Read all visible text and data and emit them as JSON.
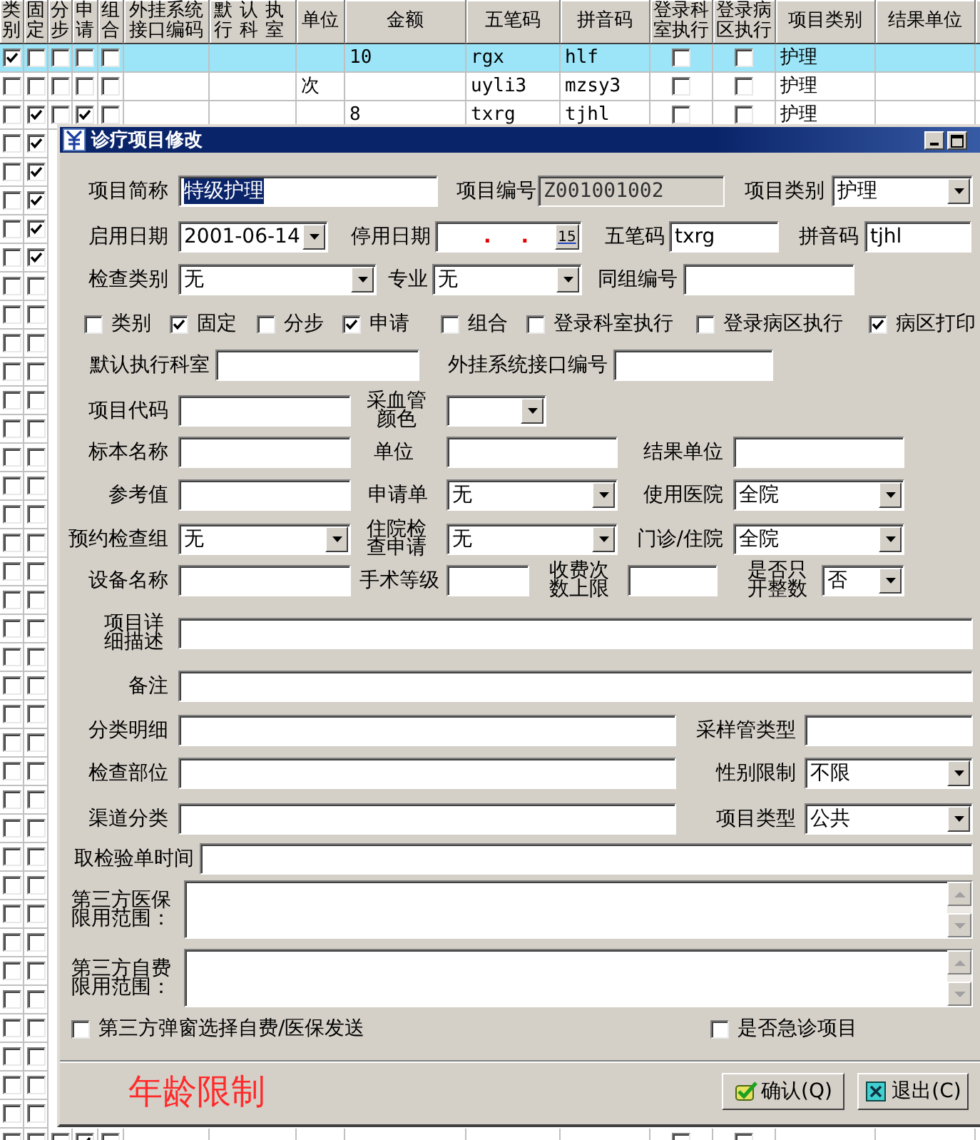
{
  "grid": {
    "columns": [
      "类别",
      "固定",
      "分步",
      "申请",
      "组合",
      "外挂系统接口编码",
      "默认执行科室",
      "单位",
      "金额",
      "五笔码",
      "拼音码",
      "登录科室执行",
      "登录病区执行",
      "项目类别",
      "结果单位"
    ],
    "rows": [
      {
        "selected": true,
        "flags": [
          true,
          false,
          false,
          false,
          false
        ],
        "amount": "10",
        "wubi": "rgx",
        "pinyin": "hlf",
        "dept_exec": false,
        "ward_exec": false,
        "category": "护理"
      },
      {
        "selected": false,
        "flags": [
          false,
          false,
          false,
          false,
          false
        ],
        "unit": "次",
        "wubi": "uyli3",
        "pinyin": "mzsy3",
        "dept_exec": false,
        "ward_exec": false,
        "category": "护理"
      },
      {
        "selected": false,
        "flags": [
          false,
          true,
          false,
          true,
          false
        ],
        "amount": "8",
        "wubi": "txrg",
        "pinyin": "tjhl",
        "dept_exec": false,
        "ward_exec": false,
        "category": "护理"
      },
      {
        "selected": false,
        "flags": [
          false,
          true
        ]
      },
      {
        "selected": false,
        "flags": [
          false,
          true
        ]
      },
      {
        "selected": false,
        "flags": [
          false,
          true
        ]
      },
      {
        "selected": false,
        "flags": [
          false,
          true
        ]
      },
      {
        "selected": false,
        "flags": [
          false,
          true
        ]
      },
      {
        "selected": false,
        "flags": [
          false,
          false
        ]
      },
      {
        "selected": false,
        "flags": [
          false,
          false
        ]
      },
      {
        "selected": false,
        "flags": [
          false,
          false
        ]
      },
      {
        "selected": false,
        "flags": [
          false,
          false
        ]
      },
      {
        "selected": false,
        "flags": [
          false,
          false
        ]
      },
      {
        "selected": false,
        "flags": [
          false,
          false
        ]
      },
      {
        "selected": false,
        "flags": [
          false,
          false
        ]
      },
      {
        "selected": false,
        "flags": [
          false,
          false
        ]
      },
      {
        "selected": false,
        "flags": [
          false,
          false
        ]
      },
      {
        "selected": false,
        "flags": [
          false,
          false
        ]
      },
      {
        "selected": false,
        "flags": [
          false,
          false
        ]
      },
      {
        "selected": false,
        "flags": [
          false,
          false
        ]
      },
      {
        "selected": false,
        "flags": [
          false,
          false
        ]
      },
      {
        "selected": false,
        "flags": [
          false,
          false
        ]
      },
      {
        "selected": false,
        "flags": [
          false,
          false
        ]
      },
      {
        "selected": false,
        "flags": [
          false,
          false
        ]
      },
      {
        "selected": false,
        "flags": [
          false,
          false
        ]
      },
      {
        "selected": false,
        "flags": [
          false,
          false
        ]
      },
      {
        "selected": false,
        "flags": [
          false,
          false
        ]
      },
      {
        "selected": false,
        "flags": [
          false,
          false
        ]
      },
      {
        "selected": false,
        "flags": [
          false,
          false
        ]
      },
      {
        "selected": false,
        "flags": [
          false,
          false
        ]
      },
      {
        "selected": false,
        "flags": [
          false,
          false
        ]
      },
      {
        "selected": false,
        "flags": [
          false,
          false
        ]
      },
      {
        "selected": false,
        "flags": [
          false,
          false
        ]
      },
      {
        "selected": false,
        "flags": [
          false,
          false
        ]
      },
      {
        "selected": false,
        "flags": [
          false,
          false
        ]
      },
      {
        "selected": false,
        "flags": [
          false,
          false
        ]
      },
      {
        "selected": false,
        "flags": [
          false,
          false
        ]
      },
      {
        "selected": false,
        "flags": [
          false,
          false
        ]
      },
      {
        "selected": false,
        "flags": [
          false,
          false,
          false,
          true,
          false
        ],
        "dept_exec": false,
        "ward_exec": false
      }
    ]
  },
  "dialog": {
    "title": "诊疗项目修改",
    "rows": [
      {
        "items": [
          {
            "kind": "label",
            "text": "项目简称"
          },
          {
            "kind": "text",
            "value": "特级护理",
            "text_selected": true
          },
          {
            "kind": "label",
            "text": "项目编号"
          },
          {
            "kind": "readonly",
            "value": "Z001001002"
          },
          {
            "kind": "label",
            "text": "项目类别"
          },
          {
            "kind": "select",
            "value": "护理"
          }
        ]
      },
      {
        "items": [
          {
            "kind": "label",
            "text": "启用日期"
          },
          {
            "kind": "select",
            "value": "2001-06-14"
          },
          {
            "kind": "label",
            "text": "停用日期"
          },
          {
            "kind": "date",
            "value": ". .",
            "button": "15"
          },
          {
            "kind": "label",
            "text": "五笔码"
          },
          {
            "kind": "text",
            "value": "txrg"
          },
          {
            "kind": "label",
            "text": "拼音码"
          },
          {
            "kind": "text",
            "value": "tjhl"
          }
        ]
      },
      {
        "items": [
          {
            "kind": "label",
            "text": "检查类别"
          },
          {
            "kind": "select",
            "value": "无"
          },
          {
            "kind": "label",
            "text": "专业"
          },
          {
            "kind": "select",
            "value": "无"
          },
          {
            "kind": "label",
            "text": "同组编号"
          },
          {
            "kind": "text"
          }
        ]
      },
      {
        "items": [
          {
            "kind": "check",
            "text": "类别",
            "checked": false
          },
          {
            "kind": "check",
            "text": "固定",
            "checked": true
          },
          {
            "kind": "check",
            "text": "分步",
            "checked": false
          },
          {
            "kind": "check",
            "text": "申请",
            "checked": true
          },
          {
            "kind": "check",
            "text": "组合",
            "checked": false
          },
          {
            "kind": "check",
            "text": "登录科室执行",
            "checked": false
          },
          {
            "kind": "check",
            "text": "登录病区执行",
            "checked": false
          },
          {
            "kind": "check",
            "text": "病区打印",
            "checked": true
          }
        ]
      },
      {
        "items": [
          {
            "kind": "label",
            "text": "默认执行科室"
          },
          {
            "kind": "text"
          },
          {
            "kind": "label",
            "text": "外挂系统接口编号"
          },
          {
            "kind": "text"
          }
        ]
      },
      {
        "items": [
          {
            "kind": "label",
            "text": "项目代码"
          },
          {
            "kind": "text"
          },
          {
            "kind": "label",
            "text": "采血管颜色"
          },
          {
            "kind": "select"
          }
        ]
      },
      {
        "items": [
          {
            "kind": "label",
            "text": "标本名称"
          },
          {
            "kind": "text"
          },
          {
            "kind": "label",
            "text": "单位"
          },
          {
            "kind": "text"
          },
          {
            "kind": "label",
            "text": "结果单位"
          },
          {
            "kind": "text"
          }
        ]
      },
      {
        "items": [
          {
            "kind": "label",
            "text": "参考值"
          },
          {
            "kind": "text"
          },
          {
            "kind": "label",
            "text": "申请单"
          },
          {
            "kind": "select",
            "value": "无"
          },
          {
            "kind": "label",
            "text": "使用医院"
          },
          {
            "kind": "select",
            "value": "全院"
          }
        ]
      },
      {
        "items": [
          {
            "kind": "label",
            "text": "预约检查组"
          },
          {
            "kind": "select",
            "value": "无"
          },
          {
            "kind": "label",
            "text": "住院检查申请"
          },
          {
            "kind": "select",
            "value": "无"
          },
          {
            "kind": "label",
            "text": "门诊/住院"
          },
          {
            "kind": "select",
            "value": "全院"
          }
        ]
      },
      {
        "items": [
          {
            "kind": "label",
            "text": "设备名称"
          },
          {
            "kind": "text"
          },
          {
            "kind": "label",
            "text": "手术等级"
          },
          {
            "kind": "text"
          },
          {
            "kind": "label",
            "text": "收费次数上限"
          },
          {
            "kind": "text"
          },
          {
            "kind": "label",
            "text": "是否只开整数"
          },
          {
            "kind": "select",
            "value": "否"
          }
        ]
      },
      {
        "items": [
          {
            "kind": "label",
            "text": "项目详细描述"
          },
          {
            "kind": "text"
          }
        ]
      },
      {
        "items": [
          {
            "kind": "label",
            "text": "备注"
          },
          {
            "kind": "text"
          }
        ]
      },
      {
        "items": [
          {
            "kind": "label",
            "text": "分类明细"
          },
          {
            "kind": "text"
          },
          {
            "kind": "label",
            "text": "采样管类型"
          },
          {
            "kind": "text"
          }
        ]
      },
      {
        "items": [
          {
            "kind": "label",
            "text": "检查部位"
          },
          {
            "kind": "text"
          },
          {
            "kind": "label",
            "text": "性别限制"
          },
          {
            "kind": "select",
            "value": "不限"
          }
        ]
      },
      {
        "items": [
          {
            "kind": "label",
            "text": "渠道分类"
          },
          {
            "kind": "text"
          },
          {
            "kind": "label",
            "text": "项目类型"
          },
          {
            "kind": "select",
            "value": "公共"
          }
        ]
      },
      {
        "items": [
          {
            "kind": "label",
            "text": "取检验单时间"
          },
          {
            "kind": "text"
          }
        ]
      },
      {
        "items": [
          {
            "kind": "label",
            "text": "第三方医保限用范围："
          },
          {
            "kind": "memo"
          }
        ]
      },
      {
        "items": [
          {
            "kind": "label",
            "text": "第三方自费限用范围："
          },
          {
            "kind": "memo"
          }
        ]
      },
      {
        "items": [
          {
            "kind": "check",
            "text": "第三方弹窗选择自费/医保发送",
            "checked": false
          },
          {
            "kind": "check",
            "text": "是否急诊项目",
            "checked": false
          }
        ]
      }
    ],
    "age_limit_label": "年龄限制",
    "buttons": [
      "确认(Q)",
      "退出(C)"
    ]
  }
}
